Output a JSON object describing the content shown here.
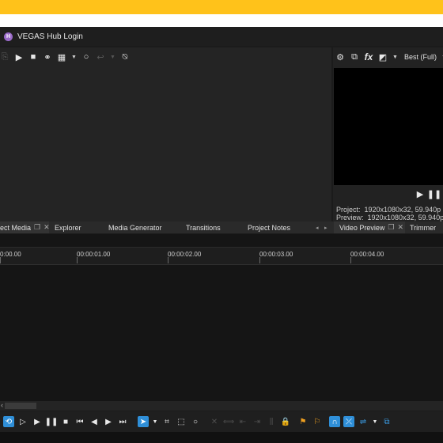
{
  "window": {
    "title": "VEGAS Hub Login",
    "app_icon_letter": "H"
  },
  "media_toolbar": {
    "icons": [
      "import-media-icon",
      "play-icon",
      "stop-icon",
      "media-fx-icon",
      "view-icon",
      "chevron-down-icon",
      "search-icon",
      "undo-icon",
      "chevron-down-icon",
      "media-properties-icon"
    ]
  },
  "preview": {
    "quality": "Best (Full)",
    "project_info": "Project:  1920x1080x32, 59.940p",
    "preview_info": "Preview:  1920x1080x32, 59.940p"
  },
  "tabs": {
    "project_media": "ect Media",
    "explorer": "Explorer",
    "media_generator": "Media Generator",
    "transitions": "Transitions",
    "project_notes": "Project Notes",
    "video_preview": "Video Preview",
    "trimmer": "Trimmer"
  },
  "timeline": {
    "ticks": [
      "0:00.00",
      "00:00:01.00",
      "00:00:02.00",
      "00:00:03.00",
      "00:00:04.00"
    ],
    "scroll_label": "‹"
  },
  "colors": {
    "accent": "#2f8fd8",
    "banner": "#ffc21a"
  }
}
